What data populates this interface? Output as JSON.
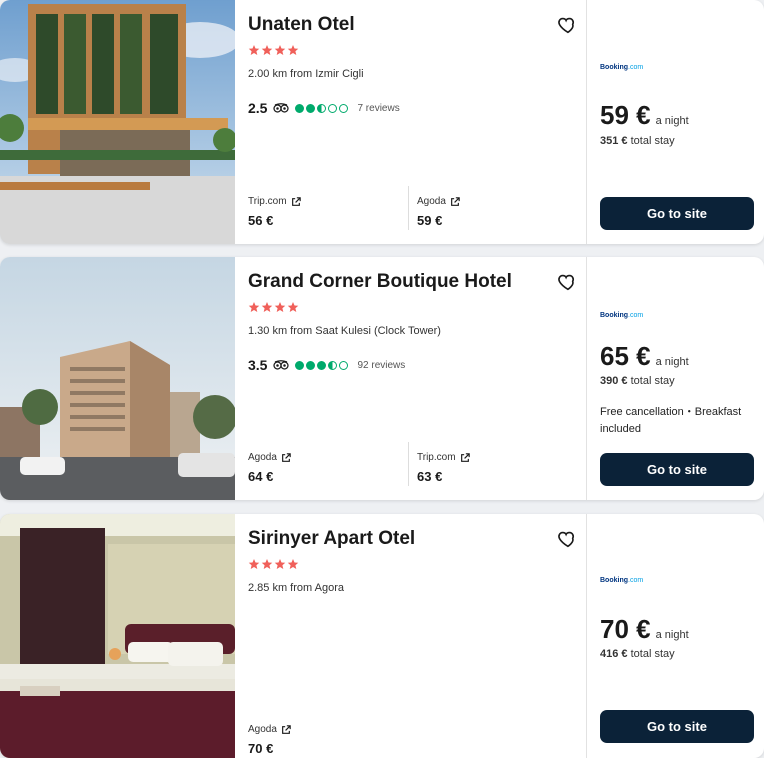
{
  "hotels": [
    {
      "name": "Unaten Otel",
      "stars": 4,
      "distance": "2.00 km from Izmir Cigli",
      "rating_score": "2.5",
      "rating_bubbles": 2.5,
      "reviews": "7 reviews",
      "providers": [
        {
          "name": "Trip.com",
          "price": "56 €"
        },
        {
          "name": "Agoda",
          "price": "59 €"
        }
      ],
      "deal": {
        "site_logo_main": "Booking",
        "site_logo_suffix": ".com",
        "price": "59 €",
        "per_night": "a night",
        "total_amount": "351 €",
        "total_label": "total stay",
        "extra": "",
        "cta": "Go to site"
      }
    },
    {
      "name": "Grand Corner Boutique Hotel",
      "stars": 4,
      "distance": "1.30 km from Saat Kulesi (Clock Tower)",
      "rating_score": "3.5",
      "rating_bubbles": 3.5,
      "reviews": "92 reviews",
      "providers": [
        {
          "name": "Agoda",
          "price": "64 €"
        },
        {
          "name": "Trip.com",
          "price": "63 €"
        }
      ],
      "deal": {
        "site_logo_main": "Booking",
        "site_logo_suffix": ".com",
        "price": "65 €",
        "per_night": "a night",
        "total_amount": "390 €",
        "total_label": "total stay",
        "extra": "Free cancellation・Breakfast included",
        "cta": "Go to site"
      }
    },
    {
      "name": "Sirinyer Apart Otel",
      "stars": 4,
      "distance": "2.85 km from Agora",
      "rating_score": "",
      "rating_bubbles": 0,
      "reviews": "",
      "providers": [
        {
          "name": "Agoda",
          "price": "70 €"
        }
      ],
      "deal": {
        "site_logo_main": "Booking",
        "site_logo_suffix": ".com",
        "price": "70 €",
        "per_night": "a night",
        "total_amount": "416 €",
        "total_label": "total stay",
        "extra": "",
        "cta": "Go to site"
      }
    }
  ],
  "colors": {
    "star": "#f0605a",
    "bubble": "#00aa6c",
    "cta_bg": "#0b2238",
    "booking_blue": "#003580"
  },
  "icons": {
    "favorite": "heart-outline-icon",
    "tripadvisor": "tripadvisor-owl-icon",
    "external": "external-link-icon",
    "star": "star-icon"
  }
}
